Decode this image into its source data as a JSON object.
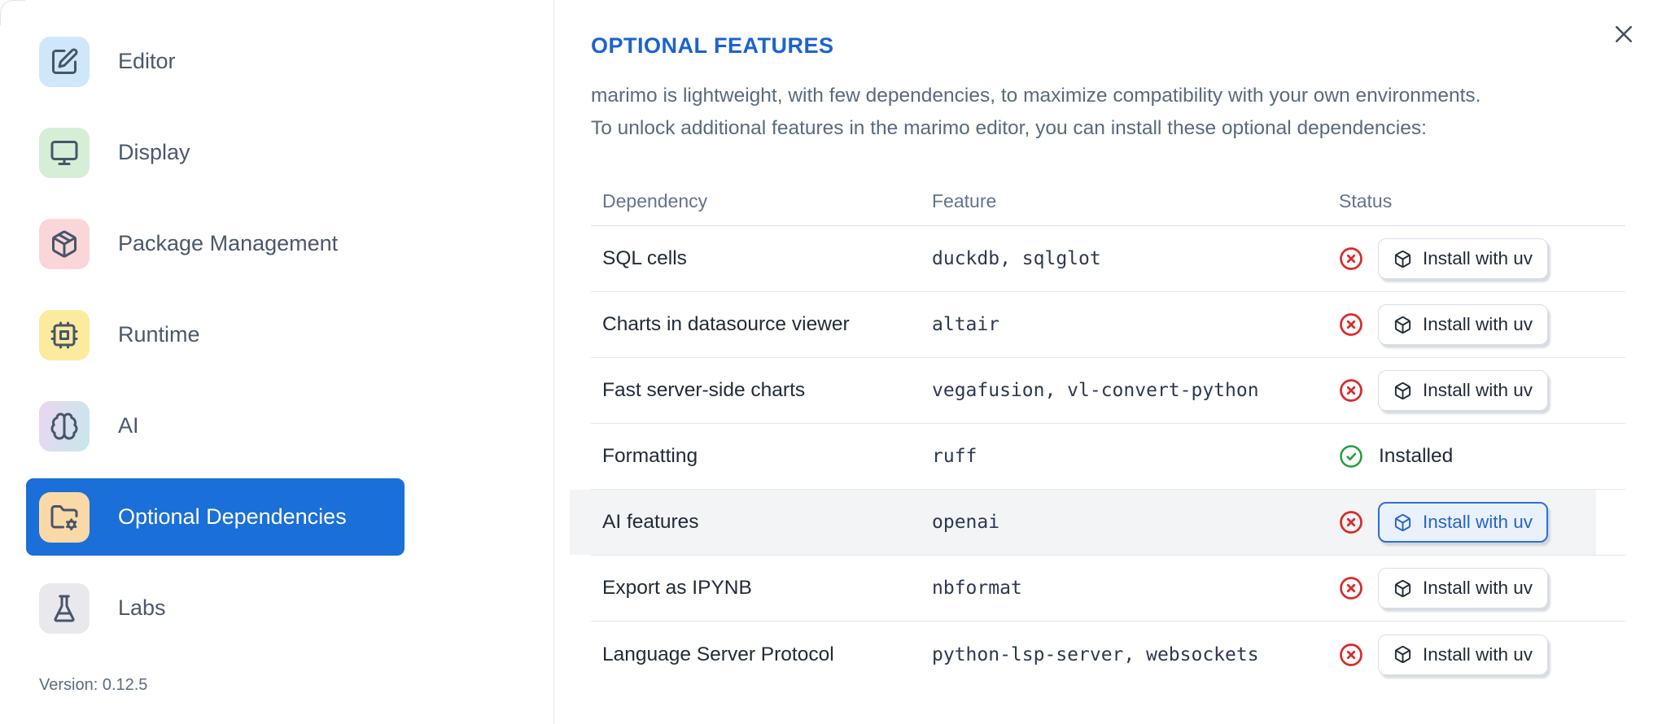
{
  "colors": {
    "accent_blue": "#1b6fd8",
    "title_blue": "#1b63d1",
    "error_red": "#d92c2c",
    "success_green": "#229d44",
    "highlight_row_bg": "#f3f4f6"
  },
  "sidebar": {
    "items": [
      {
        "label": "Editor",
        "icon": "edit-pencil-icon",
        "icon_bg": "#cfe7fa",
        "selected": false
      },
      {
        "label": "Display",
        "icon": "monitor-icon",
        "icon_bg": "#d6eed6",
        "selected": false
      },
      {
        "label": "Package Management",
        "icon": "package-icon",
        "icon_bg": "#fad6d8",
        "selected": false
      },
      {
        "label": "Runtime",
        "icon": "cpu-icon",
        "icon_bg": "#fcea9e",
        "selected": false
      },
      {
        "label": "AI",
        "icon": "brain-icon",
        "icon_bg": "linear-gradient(105deg, #ead6f2 0%, #c6e7eb 100%)",
        "selected": false
      },
      {
        "label": "Optional Dependencies",
        "icon": "folder-gear-icon",
        "icon_bg": "#fbd9a6",
        "selected": true
      },
      {
        "label": "Labs",
        "icon": "flask-icon",
        "icon_bg": "#e9e9ed",
        "selected": false
      }
    ],
    "version_label": "Version: 0.12.5"
  },
  "panel": {
    "title": "OPTIONAL FEATURES",
    "description_lines": [
      "marimo is lightweight, with few dependencies, to maximize compatibility with your own environments.",
      "To unlock additional features in the marimo editor, you can install these optional dependencies:"
    ]
  },
  "table": {
    "headers": [
      "Dependency",
      "Feature",
      "Status"
    ],
    "install_button_label": "Install with uv",
    "installed_label": "Installed",
    "rows": [
      {
        "dependency": "SQL cells",
        "feature": "duckdb, sqlglot",
        "installed": false,
        "highlighted": false
      },
      {
        "dependency": "Charts in datasource viewer",
        "feature": "altair",
        "installed": false,
        "highlighted": false
      },
      {
        "dependency": "Fast server-side charts",
        "feature": "vegafusion, vl-convert-python",
        "installed": false,
        "highlighted": false
      },
      {
        "dependency": "Formatting",
        "feature": "ruff",
        "installed": true,
        "highlighted": false
      },
      {
        "dependency": "AI features",
        "feature": "openai",
        "installed": false,
        "highlighted": true
      },
      {
        "dependency": "Export as IPYNB",
        "feature": "nbformat",
        "installed": false,
        "highlighted": false
      },
      {
        "dependency": "Language Server Protocol",
        "feature": "python-lsp-server, websockets",
        "installed": false,
        "highlighted": false
      }
    ]
  }
}
